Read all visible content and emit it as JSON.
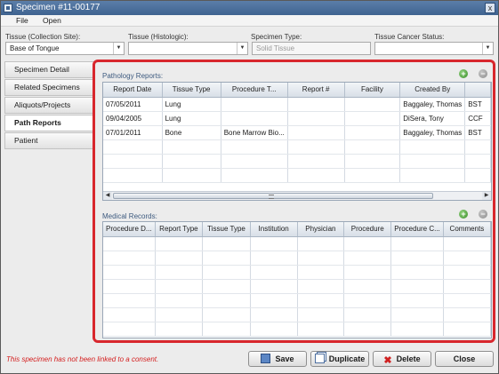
{
  "window": {
    "title": "Specimen #11-00177",
    "close_glyph": "x"
  },
  "menu": {
    "file": "File",
    "open": "Open"
  },
  "fields": {
    "tissue_collection_site": {
      "label": "Tissue (Collection Site):",
      "value": "Base of Tongue"
    },
    "tissue_histologic": {
      "label": "Tissue (Histologic):",
      "value": ""
    },
    "specimen_type": {
      "label": "Specimen Type:",
      "value": "Solid Tissue"
    },
    "tissue_cancer_status": {
      "label": "Tissue Cancer Status:",
      "value": ""
    }
  },
  "sidebar": {
    "items": [
      {
        "label": "Specimen Detail",
        "active": false
      },
      {
        "label": "Related Specimens",
        "active": false
      },
      {
        "label": "Aliquots/Projects",
        "active": false
      },
      {
        "label": "Path Reports",
        "active": true
      },
      {
        "label": "Patient",
        "active": false
      }
    ]
  },
  "pathology": {
    "section_label": "Pathology Reports:",
    "columns": [
      "Report Date",
      "Tissue Type",
      "Procedure T...",
      "Report #",
      "Facility",
      "Created By",
      ""
    ],
    "rows": [
      [
        "07/05/2011",
        "Lung",
        "",
        "",
        "",
        "Baggaley, Thomas",
        "BST"
      ],
      [
        "09/04/2005",
        "Lung",
        "",
        "",
        "",
        "DiSera, Tony",
        "CCF"
      ],
      [
        "07/01/2011",
        "Bone",
        "Bone Marrow Bio...",
        "",
        "",
        "Baggaley, Thomas",
        "BST"
      ]
    ]
  },
  "medical": {
    "section_label": "Medical Records:",
    "columns": [
      "Procedure D...",
      "Report Type",
      "Tissue Type",
      "Institution",
      "Physician",
      "Procedure",
      "Procedure C...",
      "Comments"
    ]
  },
  "footer": {
    "consent_message": "This specimen has not been linked to a consent.",
    "save": "Save",
    "duplicate": "Duplicate",
    "delete": "Delete",
    "close": "Close"
  },
  "icons": {
    "add": "add-icon",
    "remove": "remove-icon",
    "delete": "delete-icon"
  },
  "colors": {
    "highlight_border": "#d8272d",
    "consent_text": "#d42020",
    "title_bar": "#4a6f9d"
  }
}
